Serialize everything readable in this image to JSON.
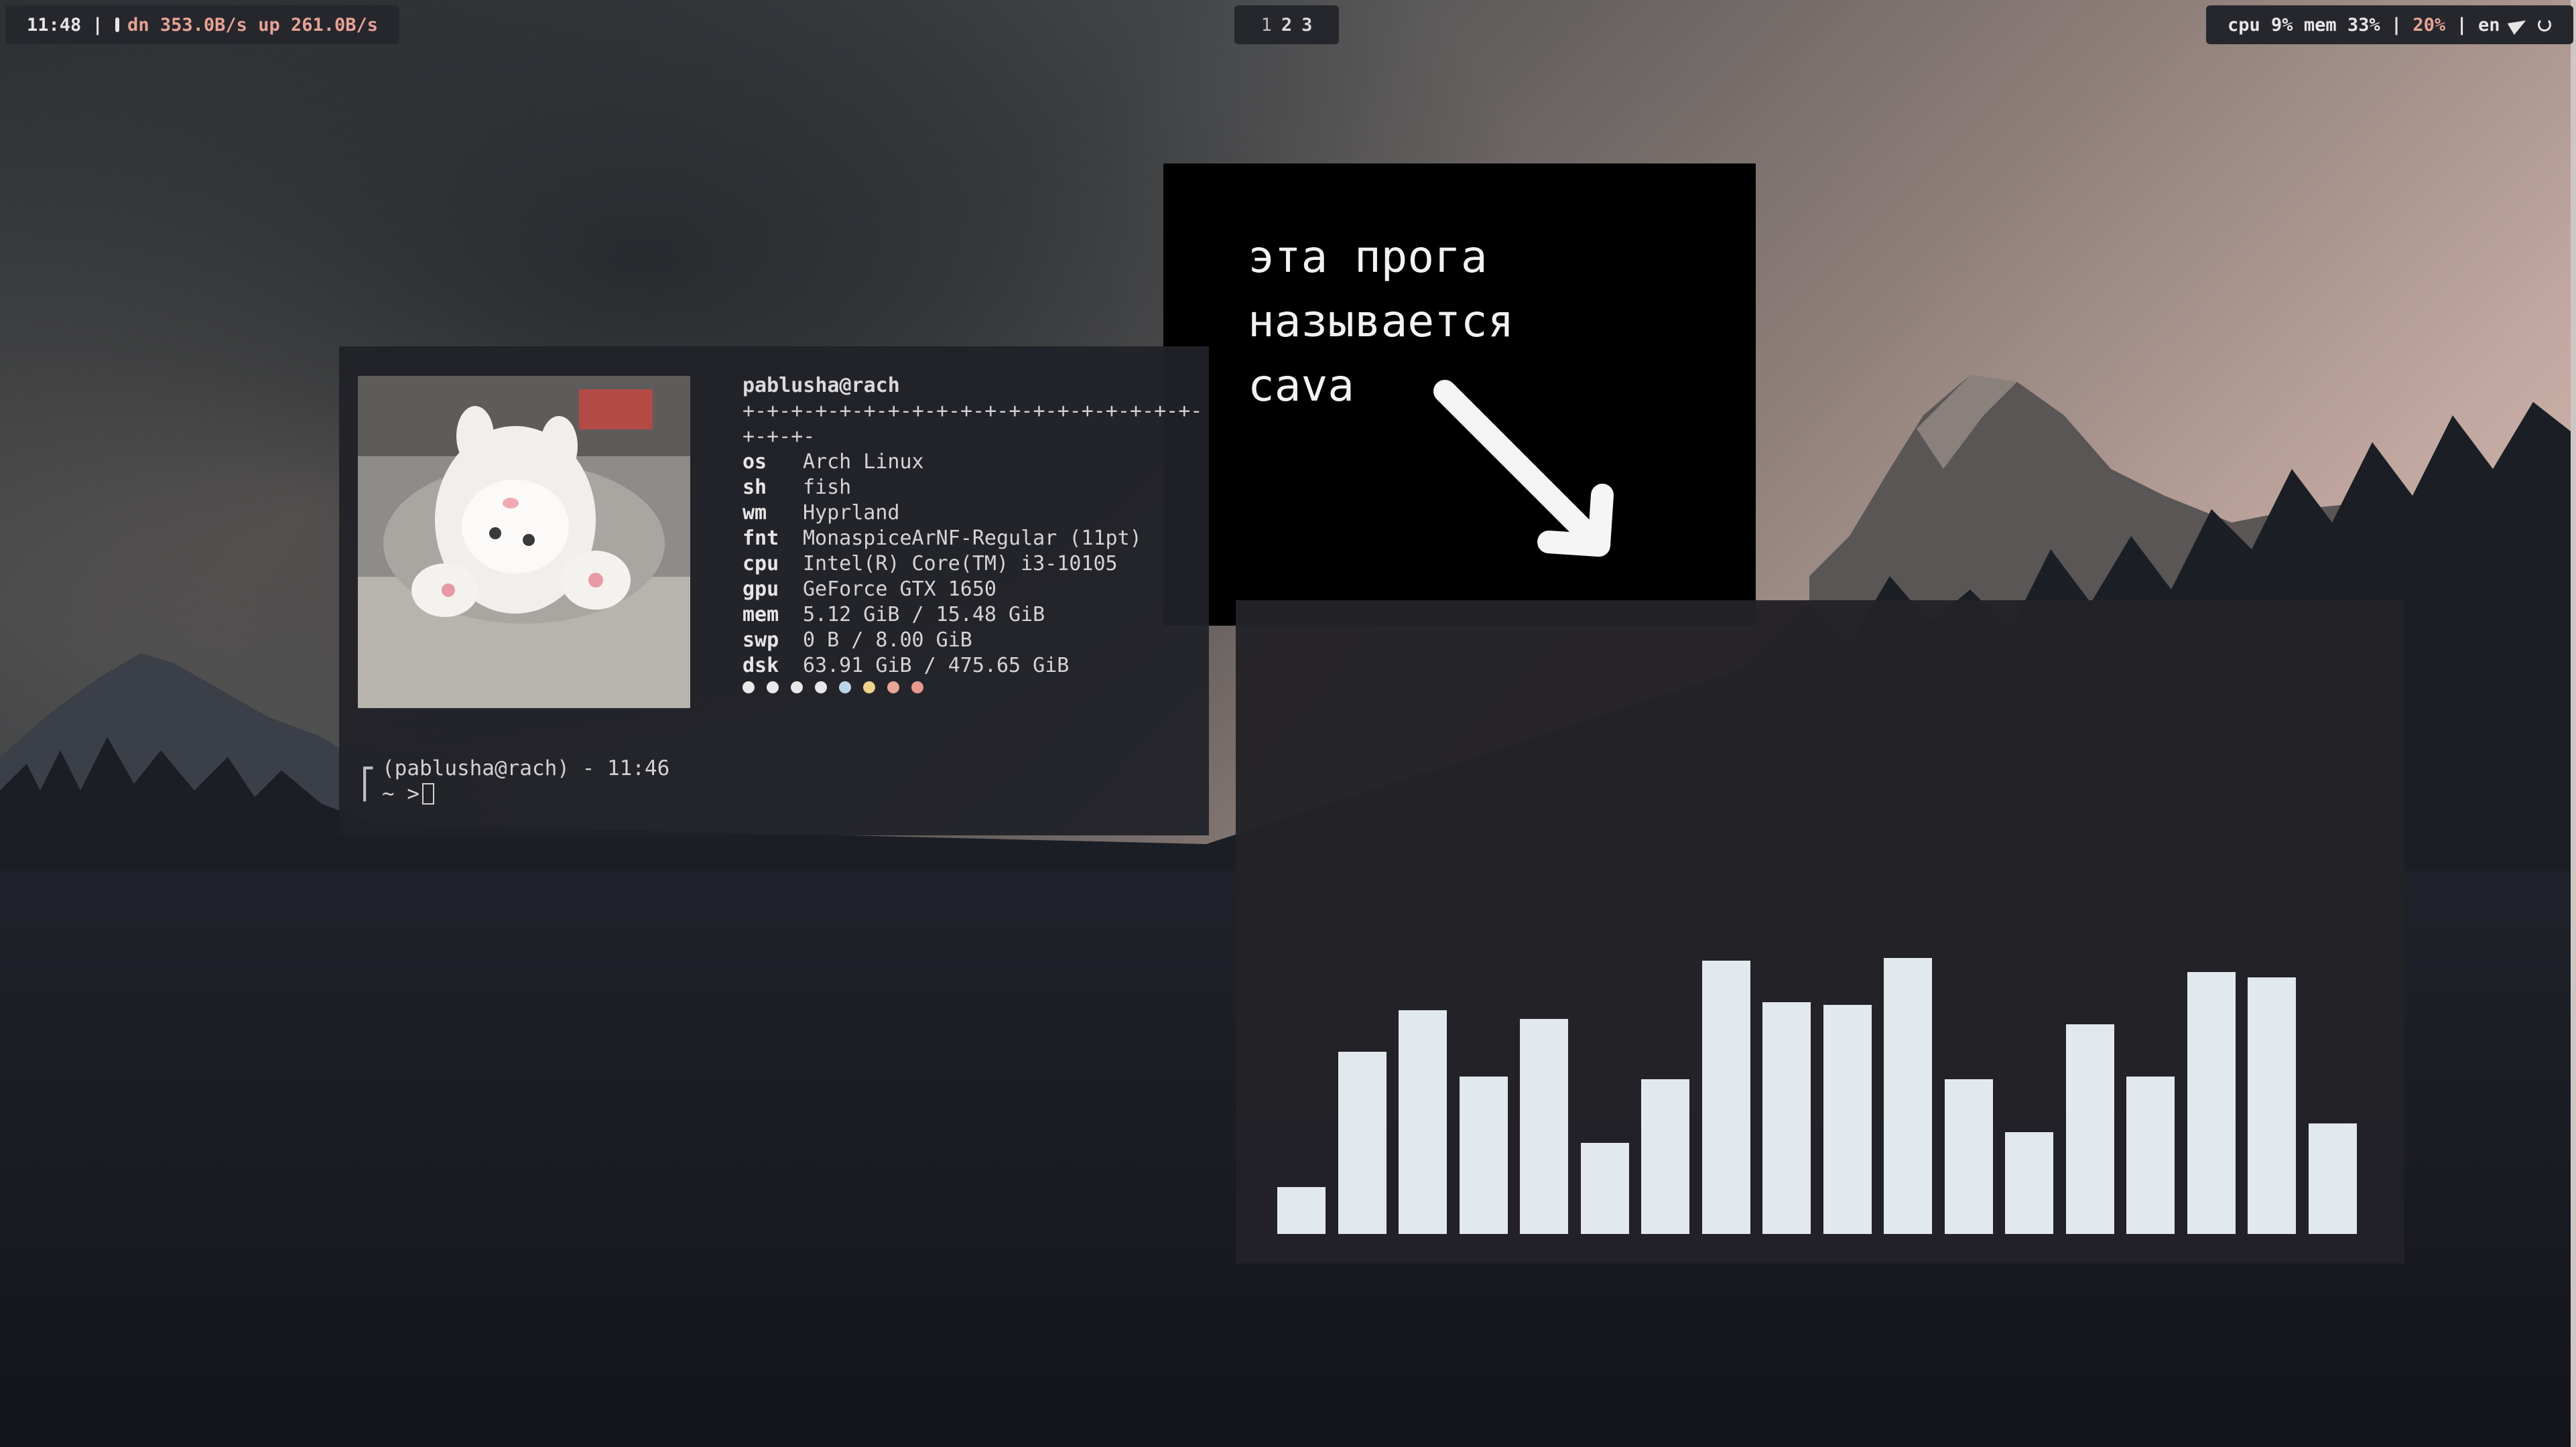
{
  "topbar": {
    "left": {
      "time": "11:48",
      "sep": "|",
      "net_down": "dn 353.0B/s",
      "net_up": "up 261.0B/s"
    },
    "workspaces": [
      "1",
      "2",
      "3"
    ],
    "right": {
      "cpu": "cpu 9%",
      "mem": "mem 33%",
      "sep": "|",
      "brightness": "20%",
      "sep2": "|",
      "lang": "en"
    }
  },
  "fastfetch": {
    "user_host": "pablusha@rach",
    "separator": "+-+-+-+-+-+-+-+-+-+-+-+-+-+-+-+-+-+-+-+-+-+-",
    "rows": [
      {
        "key": "os",
        "value": "Arch Linux"
      },
      {
        "key": "sh",
        "value": "fish"
      },
      {
        "key": "wm",
        "value": "Hyprland"
      },
      {
        "key": "fnt",
        "value": "MonaspiceArNF-Regular (11pt)"
      },
      {
        "key": "cpu",
        "value": "Intel(R) Core(TM) i3-10105"
      },
      {
        "key": "gpu",
        "value": "GeForce GTX 1650"
      },
      {
        "key": "mem",
        "value": "5.12 GiB / 15.48 GiB"
      },
      {
        "key": "swp",
        "value": "0 B / 8.00 GiB"
      },
      {
        "key": "dsk",
        "value": "63.91 GiB / 475.65 GiB"
      }
    ],
    "palette": [
      "#e9e9e9",
      "#e9e9e9",
      "#e9e9e9",
      "#e9e9e9",
      "#bcd6e9",
      "#f0d28a",
      "#e9a596",
      "#e99a8e"
    ],
    "prompt_line1": "(pablusha@rach) - 11:46",
    "prompt_line2": "~ >"
  },
  "annotation": {
    "line1": "эта прога",
    "line2": "называется",
    "line3": "cava"
  },
  "cava": {
    "bar_color": "#e1e8ee",
    "levels": [
      0.17,
      0.66,
      0.81,
      0.57,
      0.78,
      0.33,
      0.56,
      0.99,
      0.84,
      0.83,
      1.0,
      0.56,
      0.37,
      0.76,
      0.57,
      0.95,
      0.93,
      0.4
    ]
  }
}
